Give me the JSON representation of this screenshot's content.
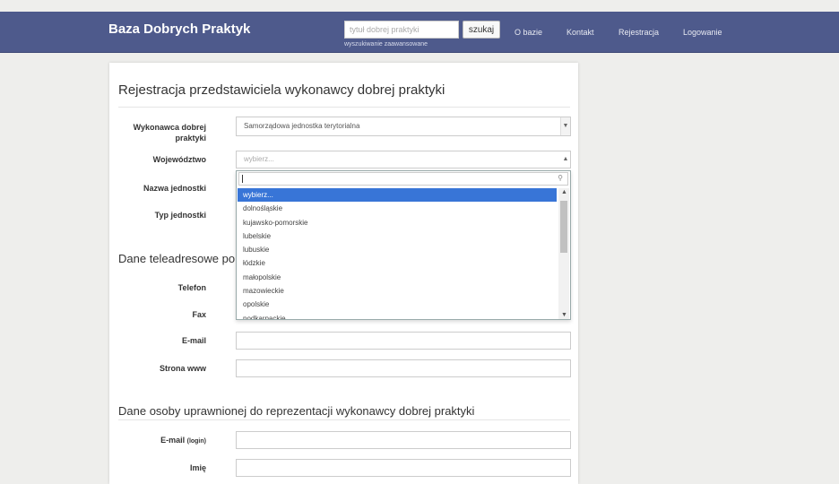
{
  "header": {
    "brand": "Baza Dobrych Praktyk",
    "search_placeholder": "tytuł dobrej praktyki",
    "search_button": "szukaj",
    "advanced_search": "wyszukiwanie zaawansowane",
    "nav": [
      "O bazie",
      "Kontakt",
      "Rejestracja",
      "Logowanie"
    ]
  },
  "page": {
    "title": "Rejestracja przedstawiciela wykonawcy dobrej praktyki"
  },
  "form": {
    "contractor_label_1": "Wykonawca dobrej",
    "contractor_label_2": "praktyki",
    "contractor_value": "Samorządowa jednostka terytorialna",
    "voivodeship_label": "Województwo",
    "voivodeship_placeholder": "wybierz...",
    "unit_name_label": "Nazwa jednostki",
    "unit_type_label": "Typ jednostki"
  },
  "contact_section": {
    "heading": "Dane teleadresowe po",
    "phone_label": "Telefon",
    "fax_label": "Fax",
    "email_label": "E-mail",
    "website_label": "Strona www"
  },
  "representative_section": {
    "heading": "Dane osoby uprawnionej do reprezentacji wykonawcy dobrej praktyki",
    "email_label": "E-mail",
    "login_hint": "(login)",
    "first_name_label": "Imię"
  },
  "dropdown": {
    "items": [
      "wybierz...",
      "dolnośląskie",
      "kujawsko-pomorskie",
      "lubelskie",
      "lubuskie",
      "łódzkie",
      "małopolskie",
      "mazowieckie",
      "opolskie",
      "podkarpackie"
    ]
  }
}
